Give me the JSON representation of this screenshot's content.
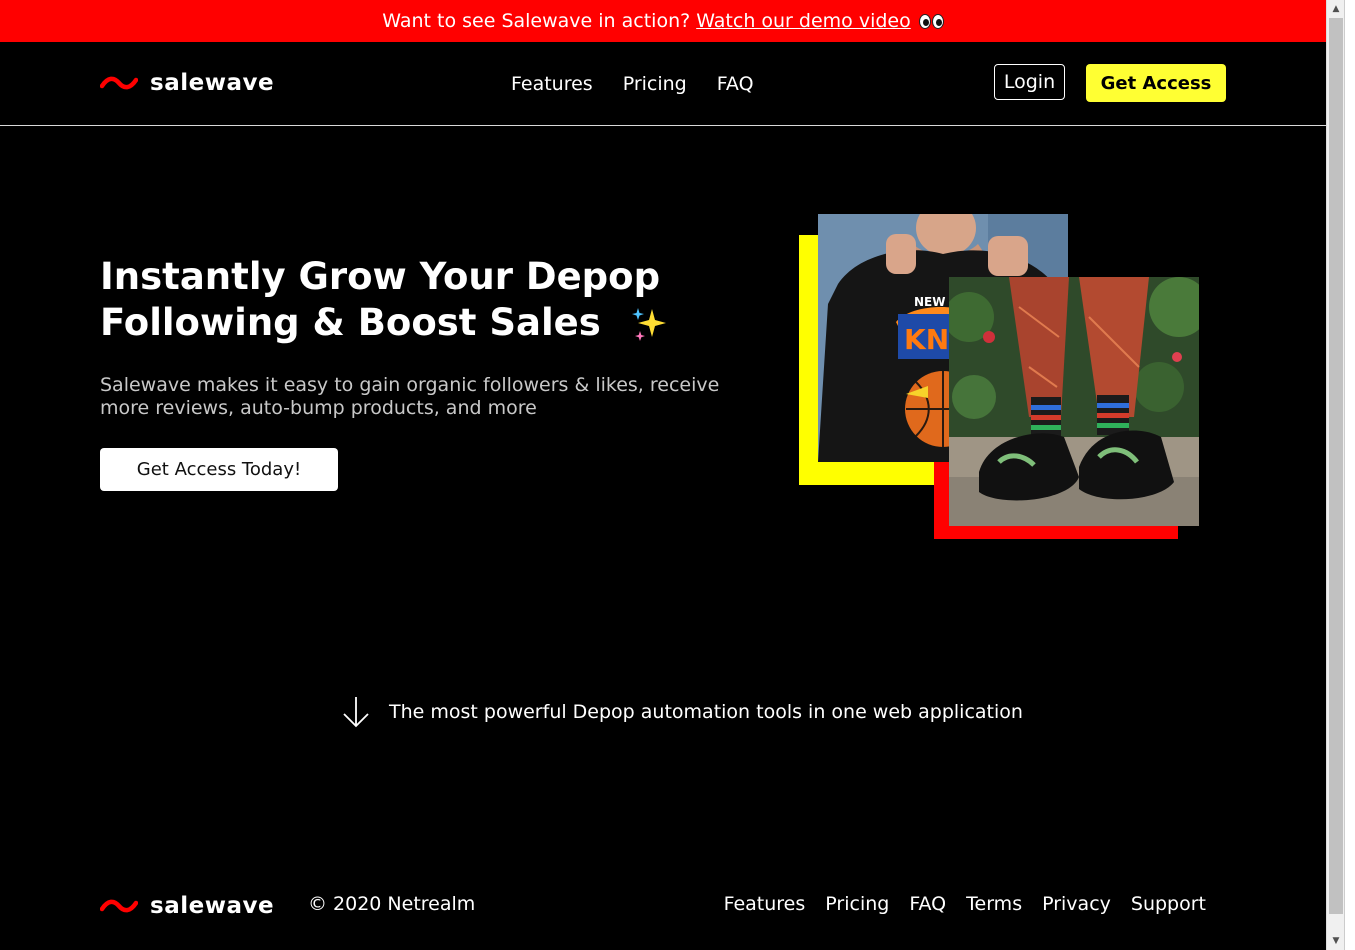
{
  "banner": {
    "text": "Want to see Salewave in action?",
    "link": "Watch our demo video",
    "emoji": "eyes-emoji"
  },
  "brand": {
    "name": "salewave",
    "accent": "#ff0000",
    "highlight": "#ffff33"
  },
  "nav": {
    "links": [
      "Features",
      "Pricing",
      "FAQ"
    ],
    "login": "Login",
    "get_access": "Get Access"
  },
  "hero": {
    "title_line1": "Instantly Grow Your Depop",
    "title_line2": "Following & Boost Sales",
    "title_emoji": "sparkles-emoji",
    "subtitle": "Salewave makes it easy to gain organic followers & likes, receive more reviews, auto-bump products, and more",
    "cta": "Get Access Today!"
  },
  "tagline": {
    "icon": "arrow-down-icon",
    "text": "The most powerful Depop automation tools in one web application"
  },
  "footer": {
    "copyright": "© 2020 Netrealm",
    "links": [
      "Features",
      "Pricing",
      "FAQ",
      "Terms",
      "Privacy",
      "Support"
    ]
  }
}
